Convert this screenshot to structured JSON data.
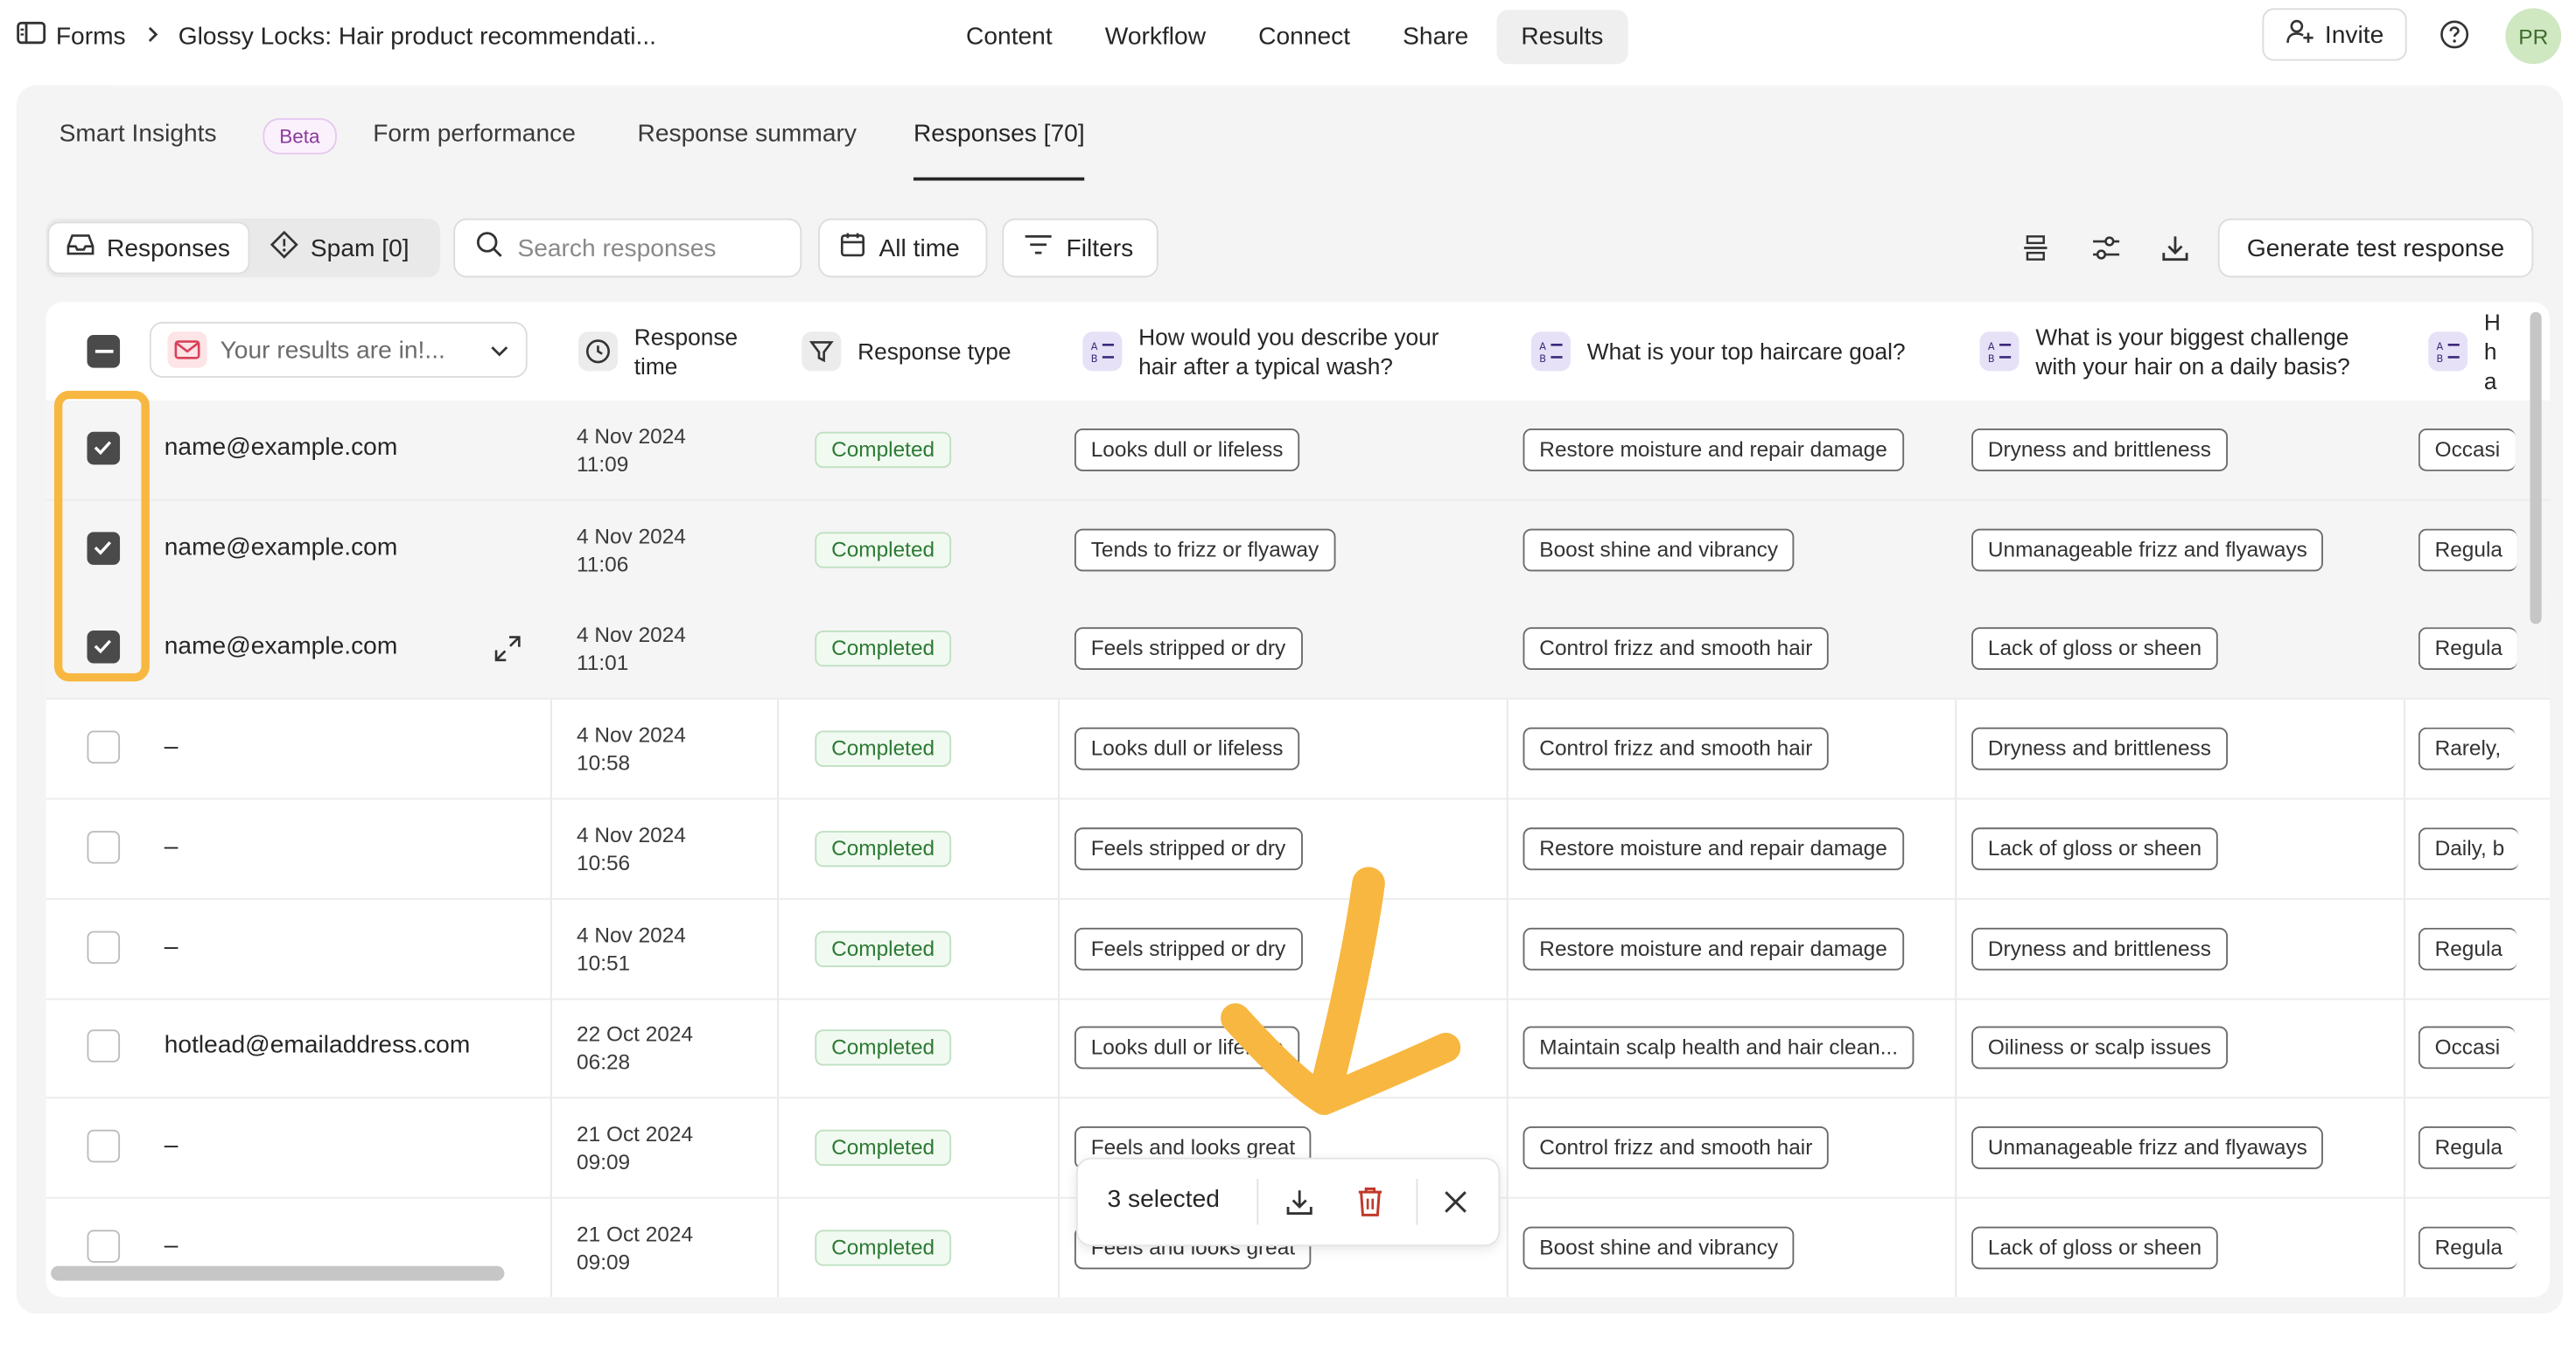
{
  "breadcrumb": {
    "root": "Forms",
    "form_name": "Glossy Locks: Hair product recommendati..."
  },
  "nav": {
    "tabs": [
      "Content",
      "Workflow",
      "Connect",
      "Share",
      "Results"
    ],
    "active": "Results"
  },
  "header": {
    "invite_label": "Invite",
    "avatar_initials": "PR"
  },
  "subtabs": {
    "smart_insights": "Smart Insights",
    "beta": "Beta",
    "form_performance": "Form performance",
    "response_summary": "Response summary",
    "responses": "Responses [70]"
  },
  "toolbar": {
    "responses": "Responses",
    "spam": "Spam [0]",
    "search_placeholder": "Search responses",
    "time_filter": "All time",
    "filters": "Filters",
    "generate": "Generate test response"
  },
  "table": {
    "email_column": "Your results are in!...",
    "columns": [
      "Response time",
      "Response type",
      "How would you describe your hair after a typical wash?",
      "What is your top haircare goal?",
      "What is your biggest challenge with your hair on a daily basis?",
      "H ha"
    ],
    "rows": [
      {
        "email": "name@example.com",
        "date": "4 Nov 2024",
        "time": "11:09",
        "type": "Completed",
        "q1": "Looks dull or lifeless",
        "q2": "Restore moisture and repair damage",
        "q3": "Dryness and brittleness",
        "q4": "Occasi"
      },
      {
        "email": "name@example.com",
        "date": "4 Nov 2024",
        "time": "11:06",
        "type": "Completed",
        "q1": "Tends to frizz or flyaway",
        "q2": "Boost shine and vibrancy",
        "q3": "Unmanageable frizz and flyaways",
        "q4": "Regula"
      },
      {
        "email": "name@example.com",
        "date": "4 Nov 2024",
        "time": "11:01",
        "type": "Completed",
        "q1": "Feels stripped or dry",
        "q2": "Control frizz and smooth hair",
        "q3": "Lack of gloss or sheen",
        "q4": "Regula"
      },
      {
        "email": "–",
        "date": "4 Nov 2024",
        "time": "10:58",
        "type": "Completed",
        "q1": "Looks dull or lifeless",
        "q2": "Control frizz and smooth hair",
        "q3": "Dryness and brittleness",
        "q4": "Rarely,"
      },
      {
        "email": "–",
        "date": "4 Nov 2024",
        "time": "10:56",
        "type": "Completed",
        "q1": "Feels stripped or dry",
        "q2": "Restore moisture and repair damage",
        "q3": "Lack of gloss or sheen",
        "q4": "Daily, b"
      },
      {
        "email": "–",
        "date": "4 Nov 2024",
        "time": "10:51",
        "type": "Completed",
        "q1": "Feels stripped or dry",
        "q2": "Restore moisture and repair damage",
        "q3": "Dryness and brittleness",
        "q4": "Regula"
      },
      {
        "email": "hotlead@emailaddress.com",
        "date": "22 Oct 2024",
        "time": "06:28",
        "type": "Completed",
        "q1": "Looks dull or lifeless",
        "q2": "Maintain scalp health and hair clean...",
        "q3": "Oiliness or scalp issues",
        "q4": "Occasi"
      },
      {
        "email": "–",
        "date": "21 Oct 2024",
        "time": "09:09",
        "type": "Completed",
        "q1": "Feels and looks great",
        "q2": "Control frizz and smooth hair",
        "q3": "Unmanageable frizz and flyaways",
        "q4": "Regula"
      },
      {
        "email": "–",
        "date": "21 Oct 2024",
        "time": "09:09",
        "type": "Completed",
        "q1": "Feels and looks great",
        "q2": "Boost shine and vibrancy",
        "q3": "Lack of gloss or sheen",
        "q4": "Regula"
      }
    ],
    "checked": [
      true,
      true,
      true,
      false,
      false,
      false,
      false,
      false,
      false
    ]
  },
  "selection": {
    "label": "3 selected"
  },
  "colors": {
    "highlight": "#f8b740",
    "badge_green": "#2d7a34",
    "delete_red": "#c0392b",
    "question_icon_bg": "#e7e1f7"
  }
}
